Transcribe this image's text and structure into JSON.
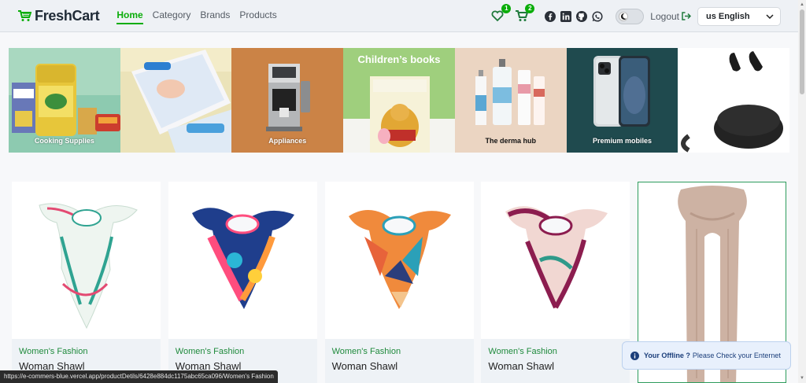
{
  "navbar": {
    "brand": "FreshCart",
    "links": [
      {
        "label": "Home",
        "active": true
      },
      {
        "label": "Category",
        "active": false
      },
      {
        "label": "Brands",
        "active": false
      },
      {
        "label": "Products",
        "active": false
      }
    ],
    "wishlist_count": "1",
    "cart_count": "2",
    "social_icons": [
      "facebook-icon",
      "linkedin-icon",
      "github-icon",
      "whatsapp-icon"
    ],
    "logout_label": "Logout",
    "language": "us English"
  },
  "slider": {
    "slides": [
      {
        "caption": "Cooking Supplies",
        "bg": "#8bc9b0"
      },
      {
        "caption": "",
        "bg": "#e9e2b6"
      },
      {
        "caption": "Appliances",
        "bg": "#cd8448"
      },
      {
        "heading": "Children’s books",
        "caption": "",
        "bg": "#9fd07f"
      },
      {
        "caption": "The derma hub",
        "bg": "#ecd6c4"
      },
      {
        "caption": "Premium mobiles",
        "bg": "#1e4b4f"
      },
      {
        "caption": "",
        "bg": "#ffffff"
      }
    ]
  },
  "products": [
    {
      "category": "Women's Fashion",
      "title": "Woman Shawl"
    },
    {
      "category": "Women's Fashion",
      "title": "Woman Shawl"
    },
    {
      "category": "Women's Fashion",
      "title": "Woman Shawl"
    },
    {
      "category": "Women's Fashion",
      "title": "Woman Shawl"
    },
    {
      "category": "",
      "title": ""
    }
  ],
  "toast": {
    "title": "Your Offline ?",
    "message": "Please Check your Enternet"
  },
  "status_url": "https://e-commers-blue.vercel.app/productDetils/6428e884dc1175abc65ca096/Women's Fashion",
  "colors": {
    "accent": "#0aad0a"
  }
}
